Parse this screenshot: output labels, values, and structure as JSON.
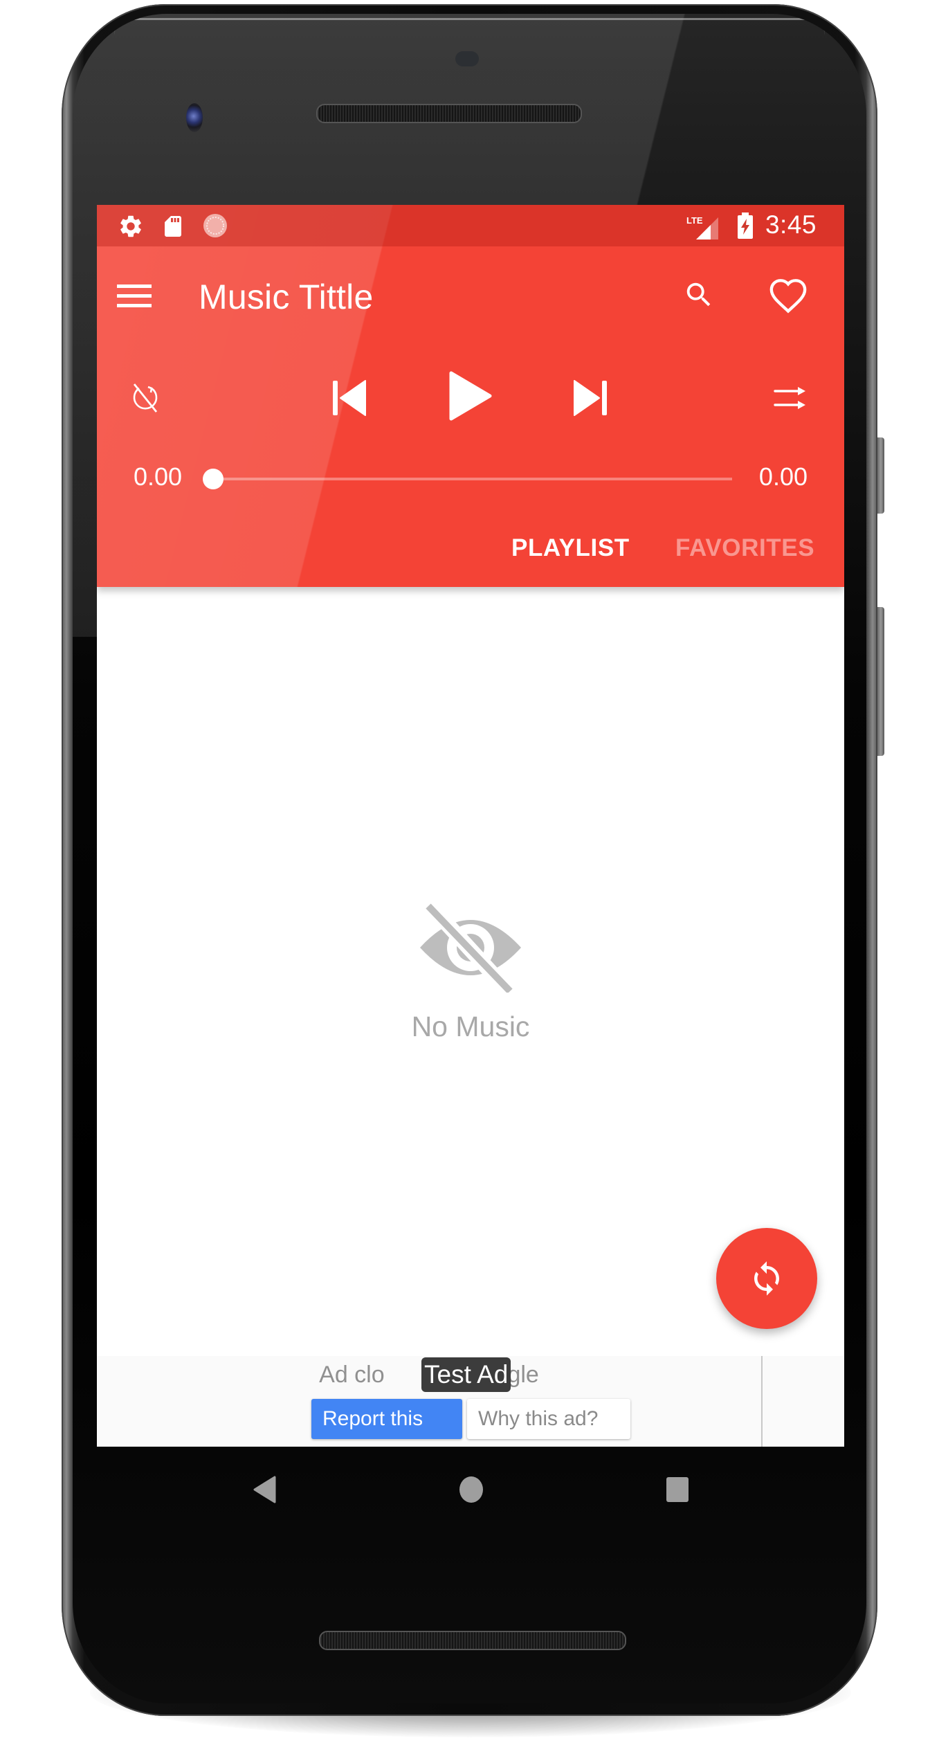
{
  "status_bar": {
    "left_icons": [
      "settings-icon",
      "sd-card-icon",
      "sync-progress-icon"
    ],
    "network": "LTE",
    "time": "3:45"
  },
  "app_bar": {
    "menu_icon": "hamburger-menu-icon",
    "title": "Music Tittle",
    "actions": [
      "search-icon",
      "heart-icon"
    ]
  },
  "player": {
    "repeat_icon": "repeat-off-icon",
    "prev_icon": "skip-previous-icon",
    "play_icon": "play-icon",
    "next_icon": "skip-next-icon",
    "shuffle_icon": "shuffle-off-icon",
    "current_time": "0.00",
    "total_time": "0.00",
    "progress": 0
  },
  "tabs": [
    {
      "label": "PLAYLIST",
      "active": true
    },
    {
      "label": "FAVORITES",
      "active": false
    }
  ],
  "empty_state": {
    "icon": "visibility-off-icon",
    "text": "No Music"
  },
  "fab": {
    "icon": "sync-icon"
  },
  "ad": {
    "closed_text_left": "Ad clo",
    "closed_text_right": "oogle",
    "badge": "Test Ad",
    "report_label": "Report this ad",
    "why_label": "Why this ad?",
    "why_icon": "adchoices-icon"
  },
  "nav_bar": [
    "back-icon",
    "home-icon",
    "recents-icon"
  ],
  "colors": {
    "primary": "#f44336",
    "status_bar": "#c8352a",
    "ad_report": "#4285f4",
    "empty_text": "#a8a8a8"
  }
}
